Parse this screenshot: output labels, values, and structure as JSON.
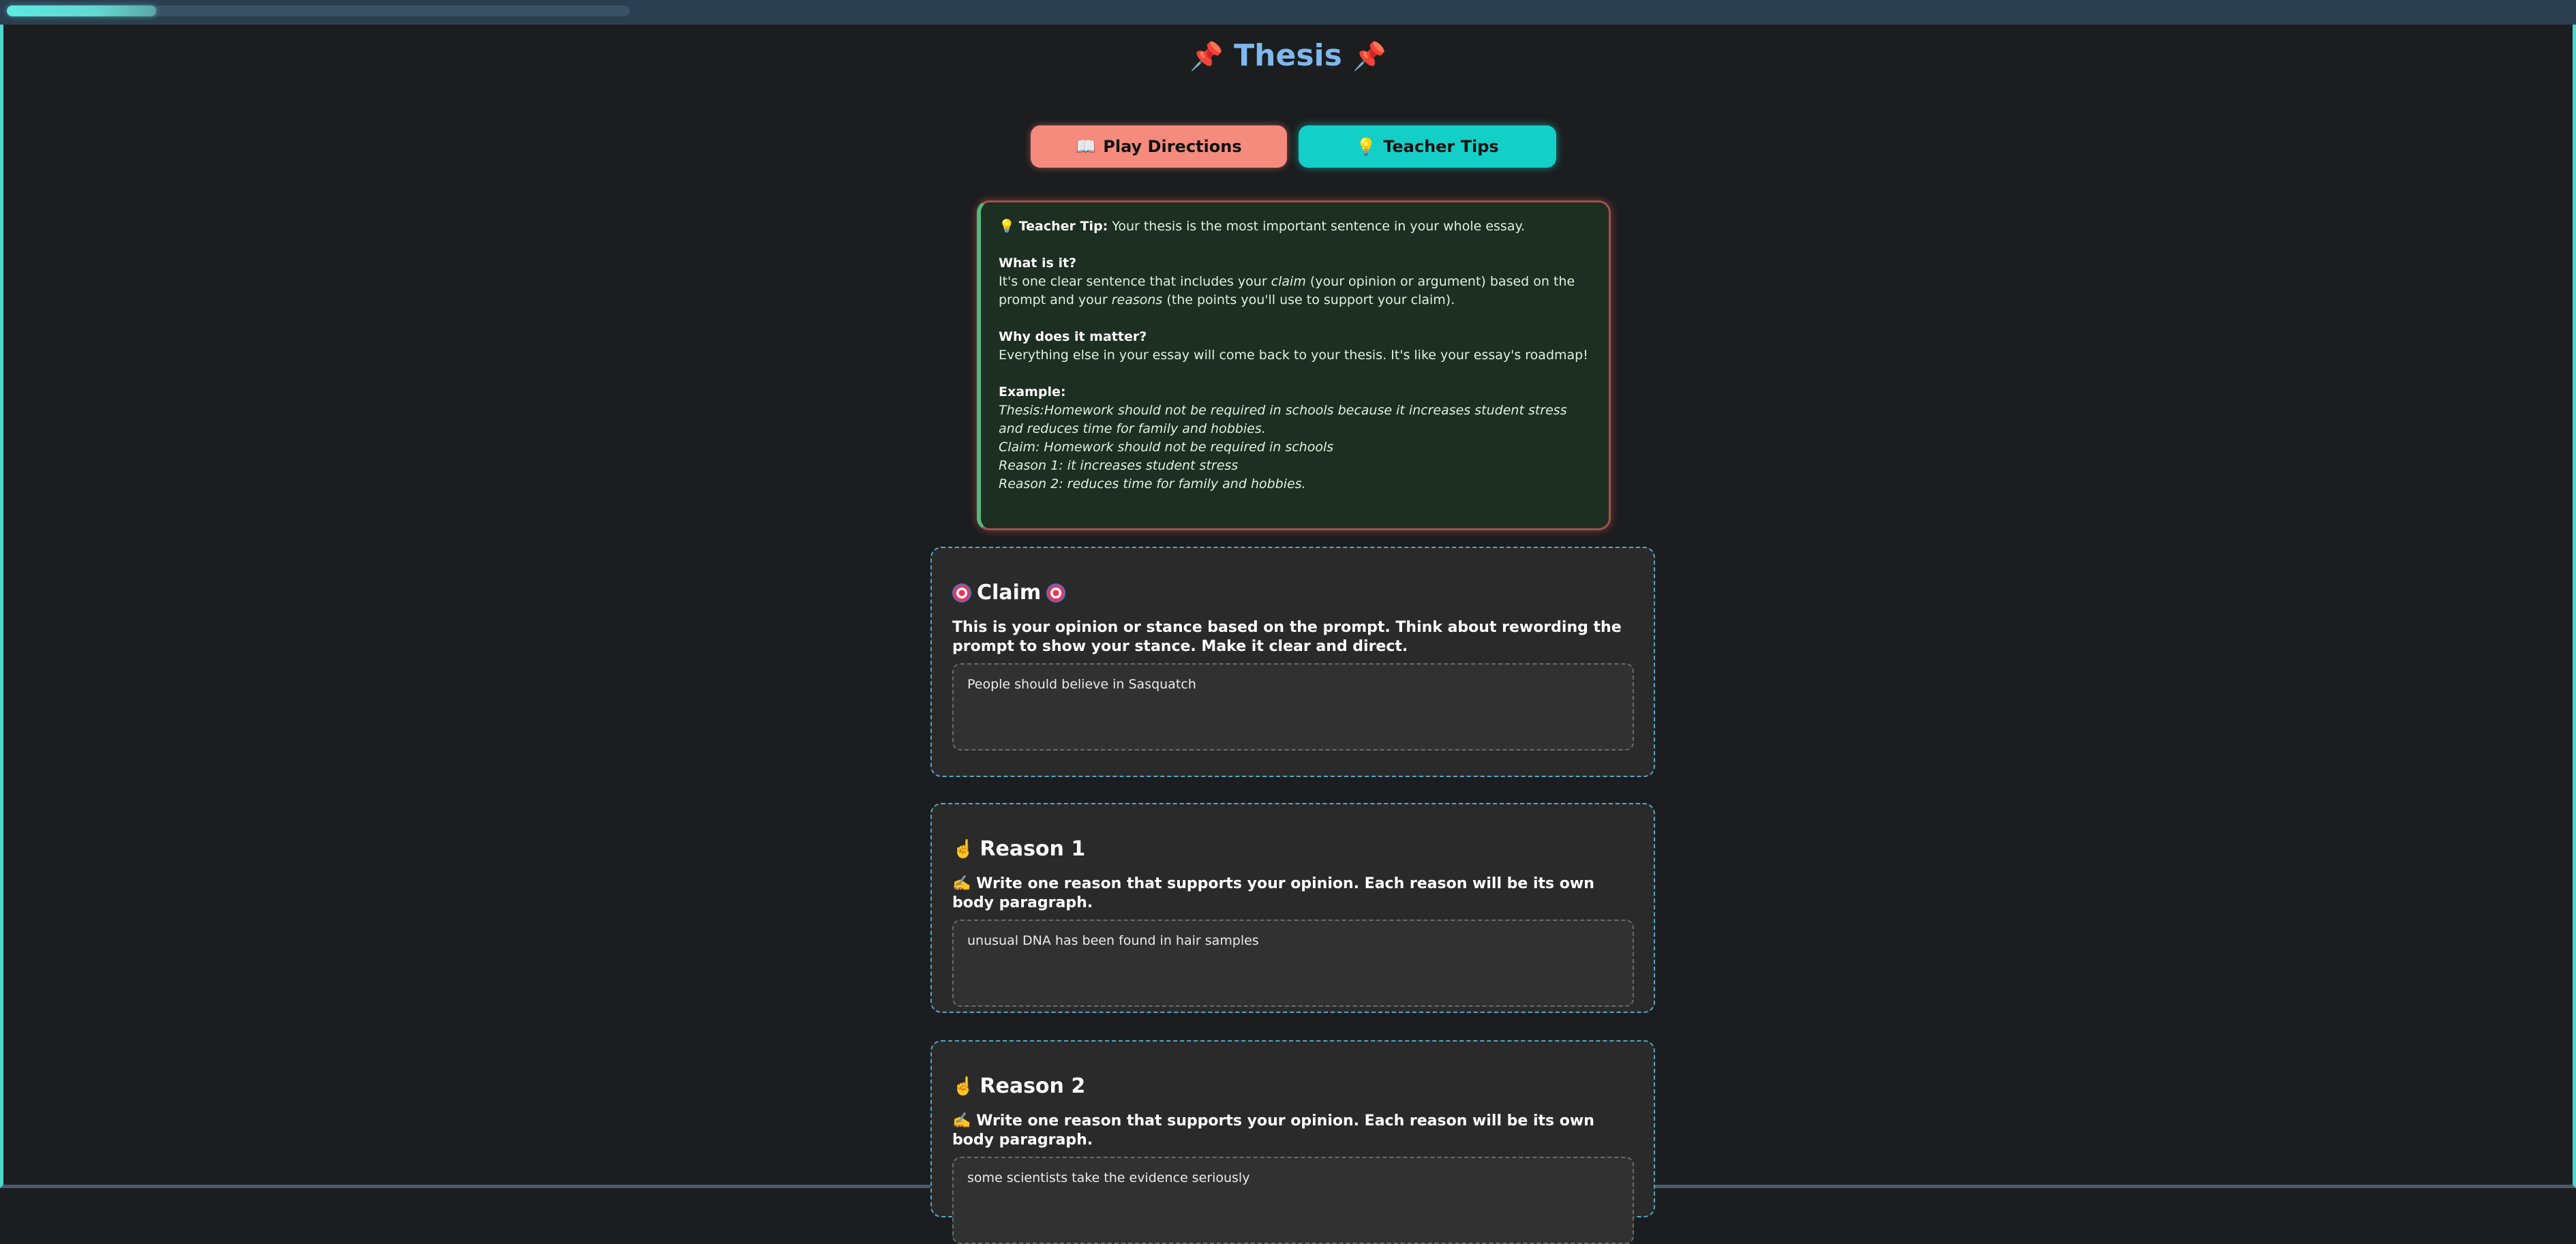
{
  "progress": {
    "fraction": 0.24
  },
  "header": {
    "title": "Thesis",
    "pin_icon": "📌"
  },
  "buttons": {
    "play": {
      "icon": "📖",
      "label": "Play Directions"
    },
    "tips": {
      "icon": "💡",
      "label": "Teacher Tips"
    }
  },
  "tip": {
    "icon": "💡",
    "lead_label": "Teacher Tip:",
    "lead_text": " Your thesis is the most important sentence in your whole essay.",
    "what_heading": "What is it?",
    "what_1": "It's one clear sentence that includes your ",
    "what_claim": "claim",
    "what_2": " (your opinion or argument) based on the prompt and your ",
    "what_reasons": "reasons",
    "what_3": " (the points you'll use to support your claim).",
    "why_heading": "Why does it matter?",
    "why_text": "Everything else in your essay will come back to your thesis. It's like your essay's roadmap!",
    "example_heading": "Example:",
    "example_lines": [
      "Thesis:Homework should not be required in schools because it increases student stress and reduces time for family and hobbies.",
      "Claim: Homework should not be required in schools",
      "Reason 1: it increases student stress",
      "Reason 2: reduces time for family and hobbies."
    ]
  },
  "claim": {
    "title": "Claim",
    "description": "This is your opinion or stance based on the prompt. Think about rewording the prompt to show your stance. Make it clear and direct.",
    "value": "People should believe in Sasquatch"
  },
  "reason1": {
    "icon": "☝️",
    "title": "Reason 1",
    "desc_icon": "✍️",
    "description": "Write one reason that supports your opinion. Each reason will be its own body paragraph.",
    "value": "unusual DNA has been found in hair samples"
  },
  "reason2": {
    "icon": "☝️",
    "title": "Reason 2",
    "desc_icon": "✍️",
    "description": "Write one reason that supports your opinion. Each reason will be its own body paragraph.",
    "value": "some scientists take the evidence seriously"
  }
}
